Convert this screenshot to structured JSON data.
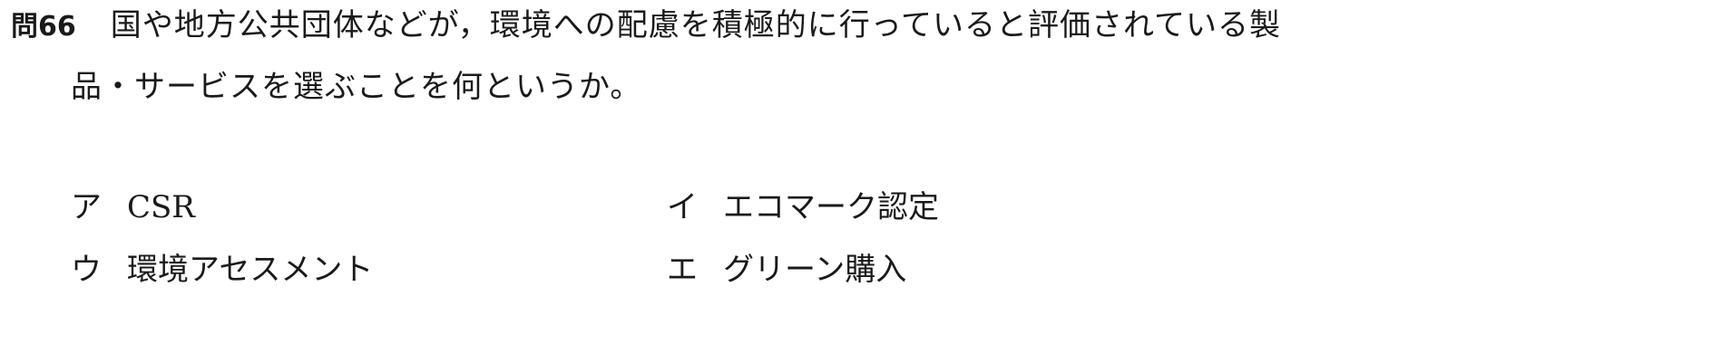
{
  "question": {
    "number": "問66",
    "text_line_1": "国や地方公共団体などが，環境への配慮を積極的に行っていると評価されている製",
    "text_line_2": "品・サービスを選ぶことを何というか。"
  },
  "choices": [
    {
      "mark": "ア",
      "text": "CSR"
    },
    {
      "mark": "イ",
      "text": "エコマーク認定"
    },
    {
      "mark": "ウ",
      "text": "環境アセスメント"
    },
    {
      "mark": "エ",
      "text": "グリーン購入"
    }
  ]
}
